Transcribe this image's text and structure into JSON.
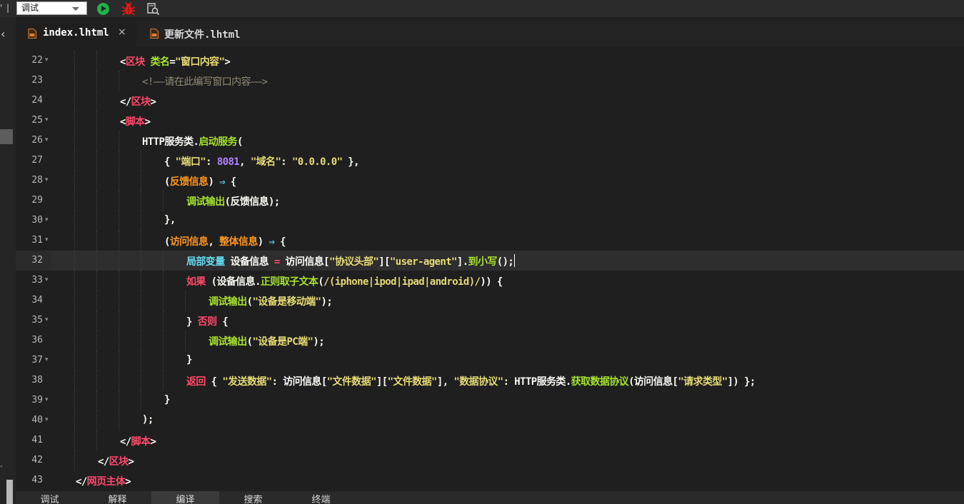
{
  "toolbar": {
    "left_fragment": [
      "'",
      "|"
    ],
    "mode_select": {
      "value": "调试"
    }
  },
  "tabs": [
    {
      "label": "index.lhtml",
      "active": true,
      "close": "×"
    },
    {
      "label": "更新文件.lhtml",
      "active": false
    }
  ],
  "editor": {
    "current_line": 32,
    "lines": [
      {
        "n": "22",
        "tokens": [
          [
            "c-punc",
            "<"
          ],
          [
            "c-tag",
            "区块"
          ],
          [
            "c-punc",
            " "
          ],
          [
            "c-attr",
            "类名"
          ],
          [
            "c-punc",
            "="
          ],
          [
            "c-str",
            "\"窗口内容\""
          ],
          [
            "c-punc",
            ">"
          ]
        ]
      },
      {
        "n": "23",
        "tokens": [
          [
            "c-cmt",
            "<!——请在此编写窗口内容——>"
          ]
        ]
      },
      {
        "n": "24",
        "tokens": [
          [
            "c-punc",
            "</"
          ],
          [
            "c-tag",
            "区块"
          ],
          [
            "c-punc",
            ">"
          ]
        ]
      },
      {
        "n": "25",
        "tokens": [
          [
            "c-punc",
            "<"
          ],
          [
            "c-tag",
            "脚本"
          ],
          [
            "c-punc",
            ">"
          ]
        ]
      },
      {
        "n": "26",
        "tokens": [
          [
            "c-punc",
            "HTTP服务类."
          ],
          [
            "c-fn",
            "启动服务"
          ],
          [
            "c-punc",
            "("
          ]
        ]
      },
      {
        "n": "27",
        "tokens": [
          [
            "c-punc",
            "{ "
          ],
          [
            "c-str",
            "\"端口\""
          ],
          [
            "c-punc",
            ": "
          ],
          [
            "c-num",
            "8081"
          ],
          [
            "c-punc",
            ", "
          ],
          [
            "c-str",
            "\"域名\""
          ],
          [
            "c-punc",
            ": "
          ],
          [
            "c-str",
            "\"0.0.0.0\""
          ],
          [
            "c-punc",
            " },"
          ]
        ]
      },
      {
        "n": "28",
        "tokens": [
          [
            "c-punc",
            "("
          ],
          [
            "c-prop",
            "反馈信息"
          ],
          [
            "c-punc",
            ") "
          ],
          [
            "c-arrow",
            "⇒"
          ],
          [
            "c-punc",
            " {"
          ]
        ]
      },
      {
        "n": "29",
        "tokens": [
          [
            "c-fn",
            "调试输出"
          ],
          [
            "c-punc",
            "(反馈信息);"
          ]
        ]
      },
      {
        "n": "30",
        "tokens": [
          [
            "c-punc",
            "},"
          ]
        ]
      },
      {
        "n": "31",
        "tokens": [
          [
            "c-punc",
            "("
          ],
          [
            "c-prop",
            "访问信息"
          ],
          [
            "c-punc",
            ", "
          ],
          [
            "c-prop",
            "整体信息"
          ],
          [
            "c-punc",
            ") "
          ],
          [
            "c-arrow",
            "⇒"
          ],
          [
            "c-punc",
            " {"
          ]
        ]
      },
      {
        "n": "32",
        "tokens": [
          [
            "c-var",
            "局部变量"
          ],
          [
            "c-punc",
            " 设备信息 "
          ],
          [
            "c-key",
            "="
          ],
          [
            "c-punc",
            " 访问信息["
          ],
          [
            "c-str",
            "\"协议头部\""
          ],
          [
            "c-punc",
            "]["
          ],
          [
            "c-str",
            "\"user-agent\""
          ],
          [
            "c-punc",
            "]."
          ],
          [
            "c-fn",
            "到小写"
          ],
          [
            "c-punc",
            "();"
          ]
        ]
      },
      {
        "n": "33",
        "tokens": [
          [
            "c-key",
            "如果"
          ],
          [
            "c-punc",
            " (设备信息."
          ],
          [
            "c-fn",
            "正则取子文本"
          ],
          [
            "c-punc",
            "("
          ],
          [
            "c-str",
            "/(iphone|ipod|ipad|android)/"
          ],
          [
            "c-punc",
            ")) {"
          ]
        ]
      },
      {
        "n": "34",
        "tokens": [
          [
            "c-fn",
            "调试输出"
          ],
          [
            "c-punc",
            "("
          ],
          [
            "c-str",
            "\"设备是移动端\""
          ],
          [
            "c-punc",
            ");"
          ]
        ]
      },
      {
        "n": "35",
        "tokens": [
          [
            "c-punc",
            "} "
          ],
          [
            "c-key",
            "否则"
          ],
          [
            "c-punc",
            " {"
          ]
        ]
      },
      {
        "n": "36",
        "tokens": [
          [
            "c-fn",
            "调试输出"
          ],
          [
            "c-punc",
            "("
          ],
          [
            "c-str",
            "\"设备是PC端\""
          ],
          [
            "c-punc",
            ");"
          ]
        ]
      },
      {
        "n": "37",
        "tokens": [
          [
            "c-punc",
            "}"
          ]
        ]
      },
      {
        "n": "38",
        "tokens": [
          [
            "c-key",
            "返回"
          ],
          [
            "c-punc",
            " { "
          ],
          [
            "c-str",
            "\"发送数据\""
          ],
          [
            "c-punc",
            ": 访问信息["
          ],
          [
            "c-str",
            "\"文件数据\""
          ],
          [
            "c-punc",
            "]["
          ],
          [
            "c-str",
            "\"文件数据\""
          ],
          [
            "c-punc",
            "], "
          ],
          [
            "c-str",
            "\"数据协议\""
          ],
          [
            "c-punc",
            ": HTTP服务类."
          ],
          [
            "c-fn",
            "获取数据协议"
          ],
          [
            "c-punc",
            "(访问信息["
          ],
          [
            "c-str",
            "\"请求类型\""
          ],
          [
            "c-punc",
            "]) };"
          ]
        ]
      },
      {
        "n": "39",
        "tokens": [
          [
            "c-punc",
            "}"
          ]
        ]
      },
      {
        "n": "40",
        "tokens": [
          [
            "c-punc",
            ");"
          ]
        ]
      },
      {
        "n": "41",
        "tokens": [
          [
            "c-punc",
            "</"
          ],
          [
            "c-tag",
            "脚本"
          ],
          [
            "c-punc",
            ">"
          ]
        ]
      },
      {
        "n": "42",
        "tokens": [
          [
            "c-punc",
            "</"
          ],
          [
            "c-tag",
            "区块"
          ],
          [
            "c-punc",
            ">"
          ]
        ]
      },
      {
        "n": "43",
        "tokens": [
          [
            "c-punc",
            "</"
          ],
          [
            "c-tag",
            "网页主体"
          ],
          [
            "c-punc",
            ">"
          ]
        ]
      }
    ]
  },
  "bottom_tabs": [
    {
      "label": "调试",
      "active": false
    },
    {
      "label": "解释",
      "active": false
    },
    {
      "label": "编译",
      "active": true
    },
    {
      "label": "搜索",
      "active": false
    },
    {
      "label": "终端",
      "active": false
    }
  ],
  "colors": {
    "background": "#1f1f1f",
    "keyword": "#ff4a6b",
    "string": "#e6db74",
    "function": "#a6e22e",
    "number": "#ae81ff",
    "comment": "#8f8a76",
    "declaration": "#66d9ef",
    "run_icon": "#21b24b",
    "bug_icon": "#e01b1b"
  },
  "icons": [
    "run-icon",
    "bug-icon",
    "find-in-files-icon",
    "collapse-arrow-icon",
    "html-file-icon",
    "close-icon",
    "fold-marker-icon"
  ]
}
